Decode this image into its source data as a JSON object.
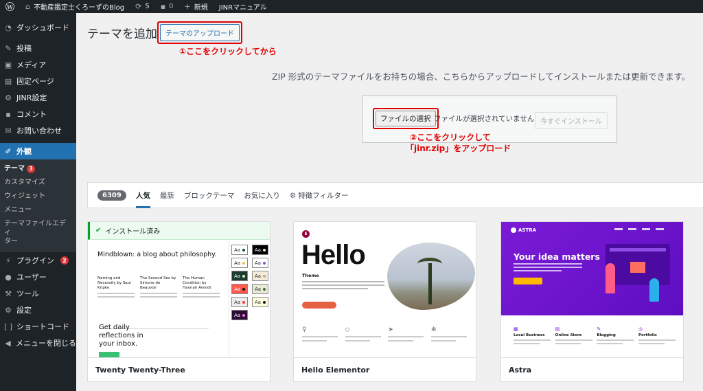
{
  "adminbar": {
    "site_name": "不動産鑑定士くろーずのBlog",
    "updates_count": "5",
    "comments_count": "0",
    "new_label": "新規",
    "manual_label": "JINRマニュアル"
  },
  "sidebar": {
    "items": [
      {
        "label": "ダッシュボード",
        "icon": "dashboard-icon"
      },
      {
        "label": "投稿",
        "icon": "pin-icon"
      },
      {
        "label": "メディア",
        "icon": "media-icon"
      },
      {
        "label": "固定ページ",
        "icon": "page-icon"
      },
      {
        "label": "JINR設定",
        "icon": "settings-icon"
      },
      {
        "label": "コメント",
        "icon": "comment-icon"
      },
      {
        "label": "お問い合わせ",
        "icon": "mail-icon"
      },
      {
        "label": "外観",
        "icon": "brush-icon"
      },
      {
        "label": "プラグイン",
        "icon": "plugin-icon",
        "badge": "2"
      },
      {
        "label": "ユーザー",
        "icon": "user-icon"
      },
      {
        "label": "ツール",
        "icon": "tool-icon"
      },
      {
        "label": "設定",
        "icon": "settings-icon"
      },
      {
        "label": "ショートコード",
        "icon": "bracket-icon"
      },
      {
        "label": "メニューを閉じる",
        "icon": "collapse-icon"
      }
    ],
    "appearance_sub": {
      "themes": "テーマ",
      "themes_badge": "3",
      "customize": "カスタマイズ",
      "widgets": "ウィジェット",
      "menus": "メニュー",
      "theme_editor_1": "テーマファイルエディ",
      "theme_editor_2": "ター"
    }
  },
  "main": {
    "title": "テーマを追加",
    "upload_button": "テーマのアップロード",
    "annotation1": "①ここをクリックしてから",
    "upload_desc": "ZIP 形式のテーマファイルをお持ちの場合、こちらからアップロードしてインストールまたは更新できます。",
    "file_button": "ファイルの選択",
    "file_status": "ファイルが選択されていません",
    "install_button": "今すぐインストール",
    "annotation2_line1": "②ここをクリックして",
    "annotation2_line2": "「jinr.zip」をアップロード"
  },
  "filters": {
    "count": "6309",
    "tabs": [
      "人気",
      "最新",
      "ブロックテーマ",
      "お気に入り"
    ],
    "feature_filter": "特徴フィルター"
  },
  "themes": [
    {
      "name": "Twenty Twenty-Three",
      "installed_label": "インストール済み",
      "heading": "Mindblown: a blog about philosophy.",
      "posts": [
        {
          "title": "Naming and Necessity by Saul Kripke"
        },
        {
          "title": "The Second Sex by Simone de Beauvoir"
        },
        {
          "title": "The Human Condition by Hannah Arendt"
        }
      ],
      "cta": "Get daily reflections in your inbox.",
      "swatch_label": "Aa"
    },
    {
      "name": "Hello Elementor",
      "hero_title": "Hello",
      "hero_sub": "Theme"
    },
    {
      "name": "Astra",
      "logo": "ASTRA",
      "hero_title": "Your idea matters",
      "features": [
        "Local Business",
        "Online Store",
        "Blogging",
        "Portfolio"
      ]
    }
  ],
  "colors": {
    "admin_dark": "#1d2327",
    "accent_blue": "#2271b1",
    "annotation_red": "#e00000",
    "installed_green": "#00a32a",
    "astra_purple": "#7b1bd6"
  }
}
